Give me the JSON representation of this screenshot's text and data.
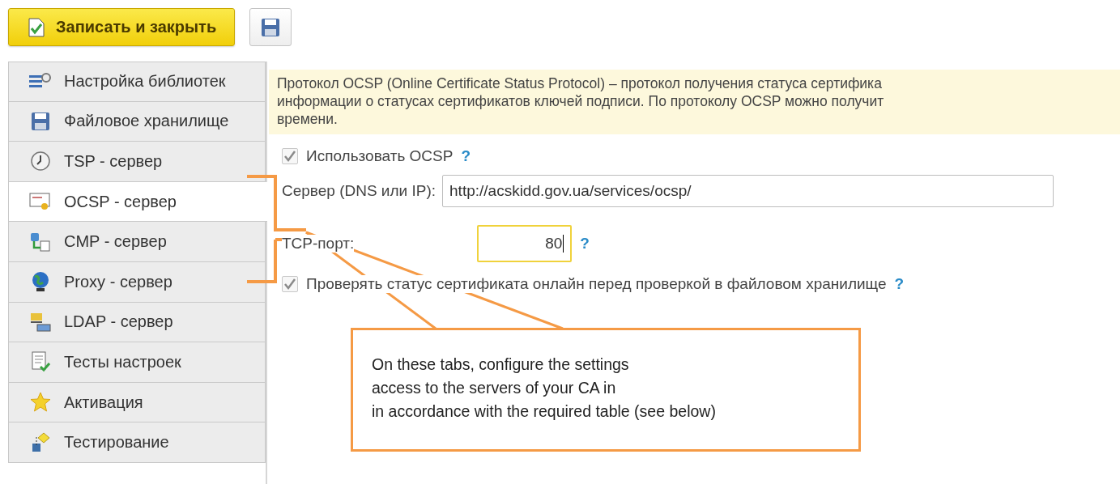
{
  "toolbar": {
    "primary_button": "Записать и закрыть"
  },
  "sidebar": {
    "items": [
      {
        "label": "Настройка библиотек",
        "selected": false
      },
      {
        "label": "Файловое хранилище",
        "selected": false
      },
      {
        "label": "TSP - сервер",
        "selected": false
      },
      {
        "label": "OCSP - сервер",
        "selected": true
      },
      {
        "label": "CMP - сервер",
        "selected": false
      },
      {
        "label": "Proxy - сервер",
        "selected": false
      },
      {
        "label": "LDAP - сервер",
        "selected": false
      },
      {
        "label": "Тесты настроек",
        "selected": false
      },
      {
        "label": "Активация",
        "selected": false
      },
      {
        "label": "Тестирование",
        "selected": false
      }
    ]
  },
  "description": [
    "Протокол OCSP (Online Certificate Status Protocol) – протокол получения статуса сертифика",
    "информации о статусах сертификатов ключей подписи. По протоколу OCSP можно получит",
    "времени."
  ],
  "use_ocsp": {
    "label": "Использовать OCSP",
    "checked": true,
    "help": "?"
  },
  "server": {
    "label": "Сервер (DNS или IP):",
    "value": "http://acskidd.gov.ua/services/ocsp/"
  },
  "port": {
    "label": "TCP-порт:",
    "value": "80",
    "focused": true,
    "help": "?"
  },
  "check_online": {
    "label": "Проверять статус сертификата онлайн перед проверкой в файловом хранилище",
    "checked": true,
    "help": "?"
  },
  "callout": {
    "lines": [
      "On these tabs, configure the settings",
      "access to the servers of your CA in",
      "in accordance with the required table (see below)"
    ]
  }
}
